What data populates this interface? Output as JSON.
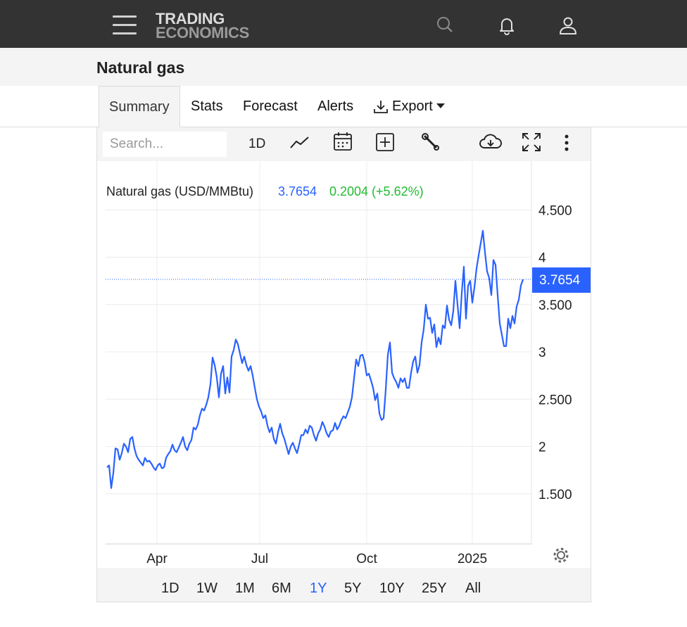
{
  "header": {
    "logo_line1": "TRADING",
    "logo_line2": "ECONOMICS",
    "icons": [
      "menu-icon",
      "search-icon",
      "bell-icon",
      "user-icon"
    ]
  },
  "page": {
    "title": "Natural gas"
  },
  "tabs": [
    {
      "label": "Summary",
      "active": true
    },
    {
      "label": "Stats"
    },
    {
      "label": "Forecast"
    },
    {
      "label": "Alerts"
    },
    {
      "label": "Export",
      "icon": "download-icon",
      "dropdown": true
    }
  ],
  "toolbar": {
    "search_placeholder": "Search...",
    "interval": "1D",
    "icons": [
      "line-chart-icon",
      "calendar-icon",
      "add-indicator-icon",
      "wrench-icon",
      "cloud-download-icon",
      "fullscreen-icon",
      "more-vertical-icon"
    ]
  },
  "legend": {
    "name": "Natural gas (USD/MMBtu)",
    "price": "3.7654",
    "change": "0.2004 (+5.62%)"
  },
  "ranges": [
    {
      "label": "1D"
    },
    {
      "label": "1W"
    },
    {
      "label": "1M"
    },
    {
      "label": "6M"
    },
    {
      "label": "1Y",
      "active": true
    },
    {
      "label": "5Y"
    },
    {
      "label": "10Y"
    },
    {
      "label": "25Y"
    },
    {
      "label": "All"
    }
  ],
  "colors": {
    "line": "#2962ff",
    "up": "#22bb33",
    "label_bg": "#2962ff"
  },
  "chart_data": {
    "type": "line",
    "title": "Natural gas (USD/MMBtu)",
    "ylim": [
      0.9,
      4.9
    ],
    "y_ticks": [
      1.5,
      2,
      2.5,
      3,
      3.5,
      4,
      4.5
    ],
    "y_tick_labels": [
      "1.500",
      "2",
      "2.500",
      "3",
      "3.500",
      "4",
      "4.500"
    ],
    "x_ticks": [
      "Apr",
      "Jul",
      "Oct",
      "2025"
    ],
    "last_value": 3.7654,
    "last_value_label": "3.7654",
    "grid": true,
    "series": [
      {
        "values": [
          1.78,
          1.8,
          1.56,
          1.72,
          1.98,
          1.97,
          1.86,
          1.93,
          2.03,
          2.0,
          1.94,
          2.08,
          2.1,
          1.98,
          1.9,
          1.86,
          1.83,
          1.8,
          1.88,
          1.84,
          1.85,
          1.82,
          1.78,
          1.75,
          1.8,
          1.82,
          1.77,
          1.78,
          1.88,
          1.92,
          1.95,
          2.02,
          1.96,
          1.94,
          1.99,
          2.04,
          2.1,
          2.0,
          1.96,
          2.03,
          2.07,
          2.2,
          2.18,
          2.23,
          2.33,
          2.4,
          2.38,
          2.44,
          2.52,
          2.66,
          2.94,
          2.86,
          2.73,
          2.52,
          2.77,
          2.85,
          2.56,
          2.73,
          2.57,
          2.95,
          3.02,
          3.13,
          3.08,
          2.98,
          2.88,
          2.95,
          2.86,
          2.8,
          2.85,
          2.75,
          2.62,
          2.5,
          2.42,
          2.37,
          2.3,
          2.33,
          2.22,
          2.15,
          2.2,
          2.08,
          2.03,
          2.15,
          2.24,
          2.14,
          2.08,
          2.0,
          1.92,
          2.0,
          2.04,
          1.98,
          1.93,
          2.02,
          2.12,
          2.12,
          2.18,
          2.14,
          2.22,
          2.2,
          2.12,
          2.06,
          2.14,
          2.18,
          2.26,
          2.21,
          2.14,
          2.1,
          2.16,
          2.17,
          2.25,
          2.18,
          2.22,
          2.28,
          2.32,
          2.3,
          2.36,
          2.42,
          2.52,
          2.72,
          2.92,
          2.85,
          2.96,
          2.97,
          2.89,
          2.75,
          2.77,
          2.7,
          2.62,
          2.49,
          2.56,
          2.35,
          2.28,
          2.3,
          2.6,
          2.97,
          3.1,
          2.78,
          2.72,
          2.68,
          2.62,
          2.72,
          2.68,
          2.72,
          2.62,
          2.62,
          2.78,
          2.9,
          2.95,
          2.78,
          2.86,
          3.1,
          3.24,
          3.5,
          3.35,
          3.36,
          3.2,
          3.29,
          3.05,
          3.15,
          3.08,
          3.28,
          3.25,
          3.49,
          3.34,
          3.28,
          3.43,
          3.75,
          3.5,
          3.25,
          3.62,
          3.9,
          3.35,
          3.7,
          3.75,
          3.52,
          3.68,
          3.88,
          4.02,
          4.15,
          4.28,
          4.05,
          3.85,
          3.78,
          3.6,
          3.97,
          3.92,
          3.6,
          3.3,
          3.18,
          3.06,
          3.06,
          3.35,
          3.25,
          3.38,
          3.3,
          3.48,
          3.55,
          3.7,
          3.7654
        ]
      }
    ]
  }
}
